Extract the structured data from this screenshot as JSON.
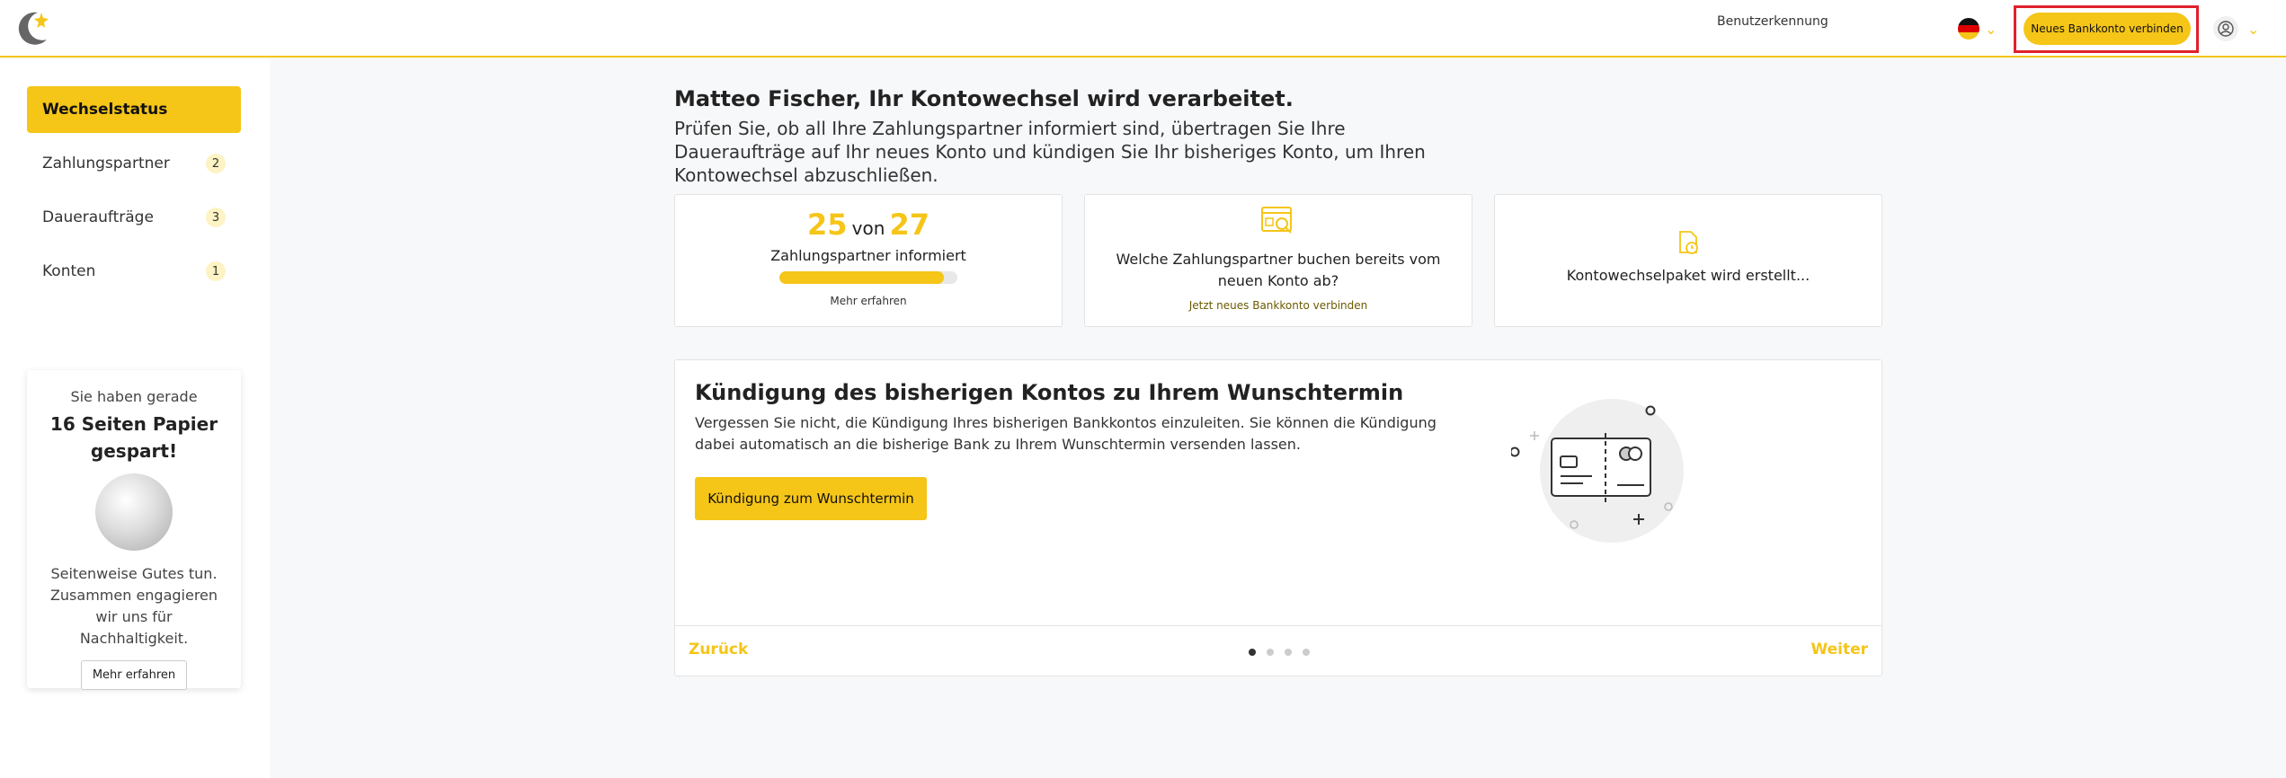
{
  "header": {
    "user_id_link": "Benutzerkennung",
    "connect_button": "Neues Bankkonto verbinden"
  },
  "sidebar": {
    "items": [
      {
        "label": "Wechselstatus",
        "badge": ""
      },
      {
        "label": "Zahlungspartner",
        "badge": "2"
      },
      {
        "label": "Daueraufträge",
        "badge": "3"
      },
      {
        "label": "Konten",
        "badge": "1"
      }
    ],
    "paper": {
      "intro": "Sie haben gerade",
      "title": "16 Seiten Papier gespart!",
      "text": "Seitenweise Gutes tun. Zusammen engagieren wir uns für Nachhaltigkeit.",
      "button": "Mehr erfahren"
    }
  },
  "main": {
    "title": "Matteo Fischer, Ihr Kontowechsel wird verarbeitet.",
    "subtitle": "Prüfen Sie, ob all Ihre Zahlungspartner informiert sind, übertragen Sie Ihre Daueraufträge auf Ihr neues Konto und kündigen Sie Ihr bisheriges Konto, um Ihren Kontowechsel abzuschließen.",
    "card_partners": {
      "informed": "25",
      "of": "von",
      "total": "27",
      "label": "Zahlungspartner informiert",
      "progress_fraction": 0.926,
      "link": "Mehr erfahren"
    },
    "card_new_account": {
      "text": "Welche Zahlungspartner buchen bereits vom neuen Konto ab?",
      "link": "Jetzt neues Bankkonto verbinden"
    },
    "card_package": {
      "text": "Kontowechselpaket wird erstellt..."
    },
    "carousel": {
      "title": "Kündigung des bisherigen Kontos zu Ihrem Wunschtermin",
      "text": "Vergessen Sie nicht, die Kündigung Ihres bisherigen Bankkontos einzuleiten. Sie können die Kündigung dabei automatisch an die bisherige Bank zu Ihrem Wunschtermin versenden lassen.",
      "button": "Kündigung zum Wunschtermin",
      "back": "Zurück",
      "next": "Weiter",
      "slide_count": 4,
      "active_slide": 1
    }
  },
  "colors": {
    "accent": "#f5c518",
    "highlight": "#e0202b"
  },
  "icons": [
    "logo-icon",
    "germany-flag-icon",
    "chevron-down-icon",
    "user-icon",
    "search-browser-icon",
    "document-clock-icon",
    "card-illustration"
  ]
}
